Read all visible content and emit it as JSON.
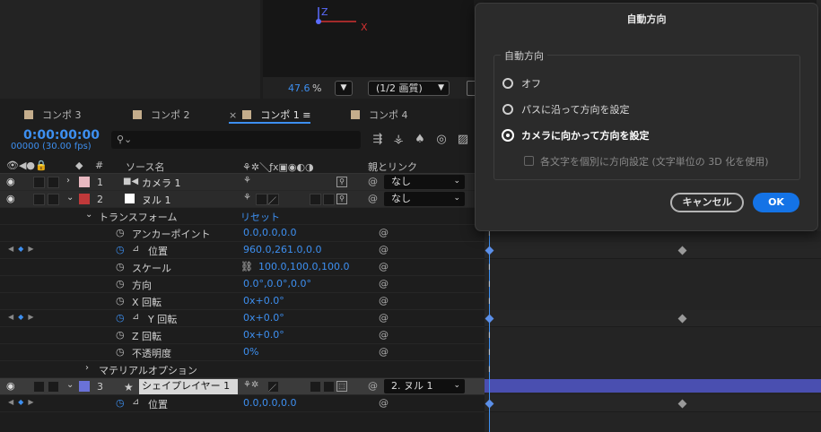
{
  "viewer": {
    "zoom_value": "47.6",
    "zoom_unit": "%",
    "resolution": "(1/2 画質)",
    "axis_z": "Z",
    "axis_x": "X"
  },
  "tabs": [
    {
      "label": "コンポ 3"
    },
    {
      "label": "コンポ 2"
    },
    {
      "label": "コンポ 1",
      "close": "×",
      "menu": "≡"
    },
    {
      "label": "コンポ 4"
    }
  ],
  "time": {
    "timecode": "0:00:00:00",
    "frames_fps": "00000 (30.00 fps)"
  },
  "columns": {
    "hash": "#",
    "source_name": "ソース名",
    "parent_link": "親とリンク"
  },
  "layers": [
    {
      "num": "1",
      "name": "カメラ 1",
      "label_color": "#e9b9c1",
      "parent": "なし"
    },
    {
      "num": "2",
      "name": "ヌル 1",
      "label_color": "#c0393a",
      "parent": "なし"
    },
    {
      "num": "3",
      "name": "シェイプレイヤー 1",
      "label_color": "#6a72d8",
      "parent": "2. ヌル 1"
    }
  ],
  "transform": {
    "group_label": "トランスフォーム",
    "reset": "リセット",
    "properties": [
      {
        "name": "アンカーポイント",
        "value": "0.0,0.0,0.0"
      },
      {
        "name": "位置",
        "value": "960.0,261.0,0.0"
      },
      {
        "name": "スケール",
        "value": "100.0,100.0,100.0"
      },
      {
        "name": "方向",
        "value": "0.0°,0.0°,0.0°"
      },
      {
        "name": "X 回転",
        "value": "0x+0.0°"
      },
      {
        "name": "Y 回転",
        "value": "0x+0.0°"
      },
      {
        "name": "Z 回転",
        "value": "0x+0.0°"
      },
      {
        "name": "不透明度",
        "value": "0%"
      }
    ],
    "material_options": "マテリアルオプション"
  },
  "layer3_props": [
    {
      "name": "位置",
      "value": "0.0,0.0,0.0"
    }
  ],
  "dialog": {
    "title": "自動方向",
    "group_label": "自動方向",
    "options": [
      {
        "label": "オフ"
      },
      {
        "label": "パスに沿って方向を設定"
      },
      {
        "label": "カメラに向かって方向を設定"
      }
    ],
    "checkbox_label": "各文字を個別に方向設定 (文字単位の 3D 化を使用)",
    "cancel": "キャンセル",
    "ok": "OK"
  },
  "colors": {
    "accent": "#3d8ff0",
    "ok_button": "#1473e6",
    "layer3_bar": "#4a4fb0"
  }
}
